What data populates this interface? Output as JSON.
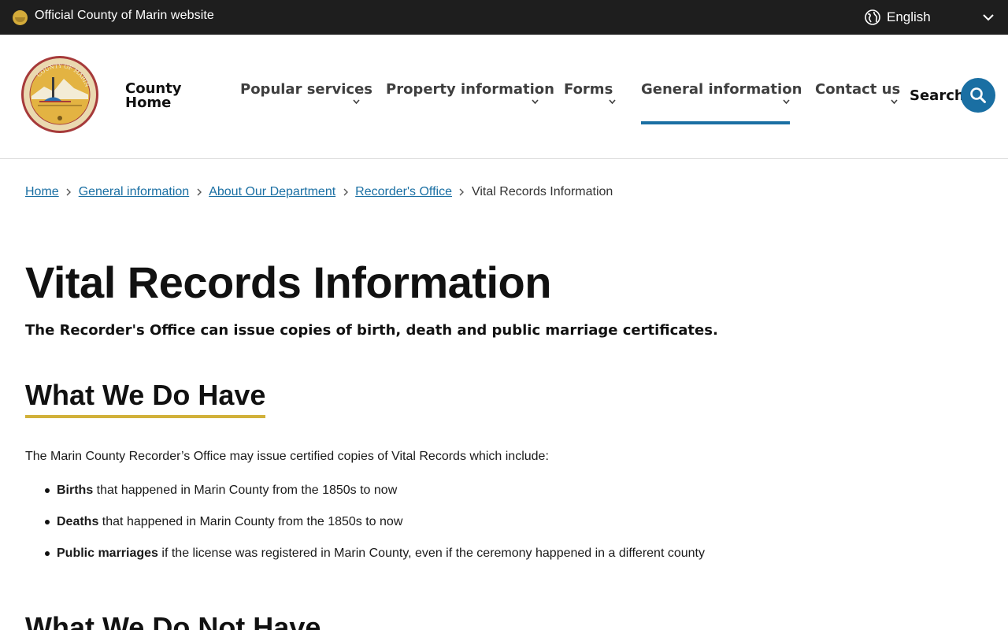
{
  "topbar": {
    "official_text": "Official County of Marin website",
    "language": "English"
  },
  "header": {
    "home_label_line1": "County",
    "home_label_line2": "Home",
    "nav": [
      {
        "label": "Popular services"
      },
      {
        "label": "Property information"
      },
      {
        "label": "Forms"
      },
      {
        "label": "General information",
        "active": true
      },
      {
        "label": "Contact us"
      }
    ],
    "search_label": "Search"
  },
  "breadcrumb": {
    "items": [
      "Home",
      "General information",
      "About Our Department",
      "Recorder's Office"
    ],
    "current": "Vital Records Information"
  },
  "main": {
    "title": "Vital Records Information",
    "lead": "The Recorder's Office can issue copies of birth, death and public marriage certificates.",
    "section1_heading": "What We Do Have",
    "section1_intro": "The Marin County Recorder’s Office may issue certified copies of Vital Records which include:",
    "list": [
      {
        "bold": "Births",
        "text": " that happened in Marin County from the 1850s to now"
      },
      {
        "bold": "Deaths",
        "text": " that happened in Marin County from the 1850s to now"
      },
      {
        "bold": "Public marriages",
        "text": " if the license was registered in Marin County, even if the ceremony happened in a different county"
      }
    ],
    "section2_heading": "What We Do Not Have"
  },
  "colors": {
    "topbar_bg": "#1e1e1e",
    "accent_blue": "#1a6fa3",
    "heading_underline": "#d1b13a",
    "seal_gold": "#d4ab3a",
    "seal_red": "#a63a3a"
  },
  "icons": [
    "seal-icon",
    "globe-icon",
    "chevron-down-icon",
    "search-icon",
    "chevron-right-icon",
    "county-seal-logo"
  ]
}
